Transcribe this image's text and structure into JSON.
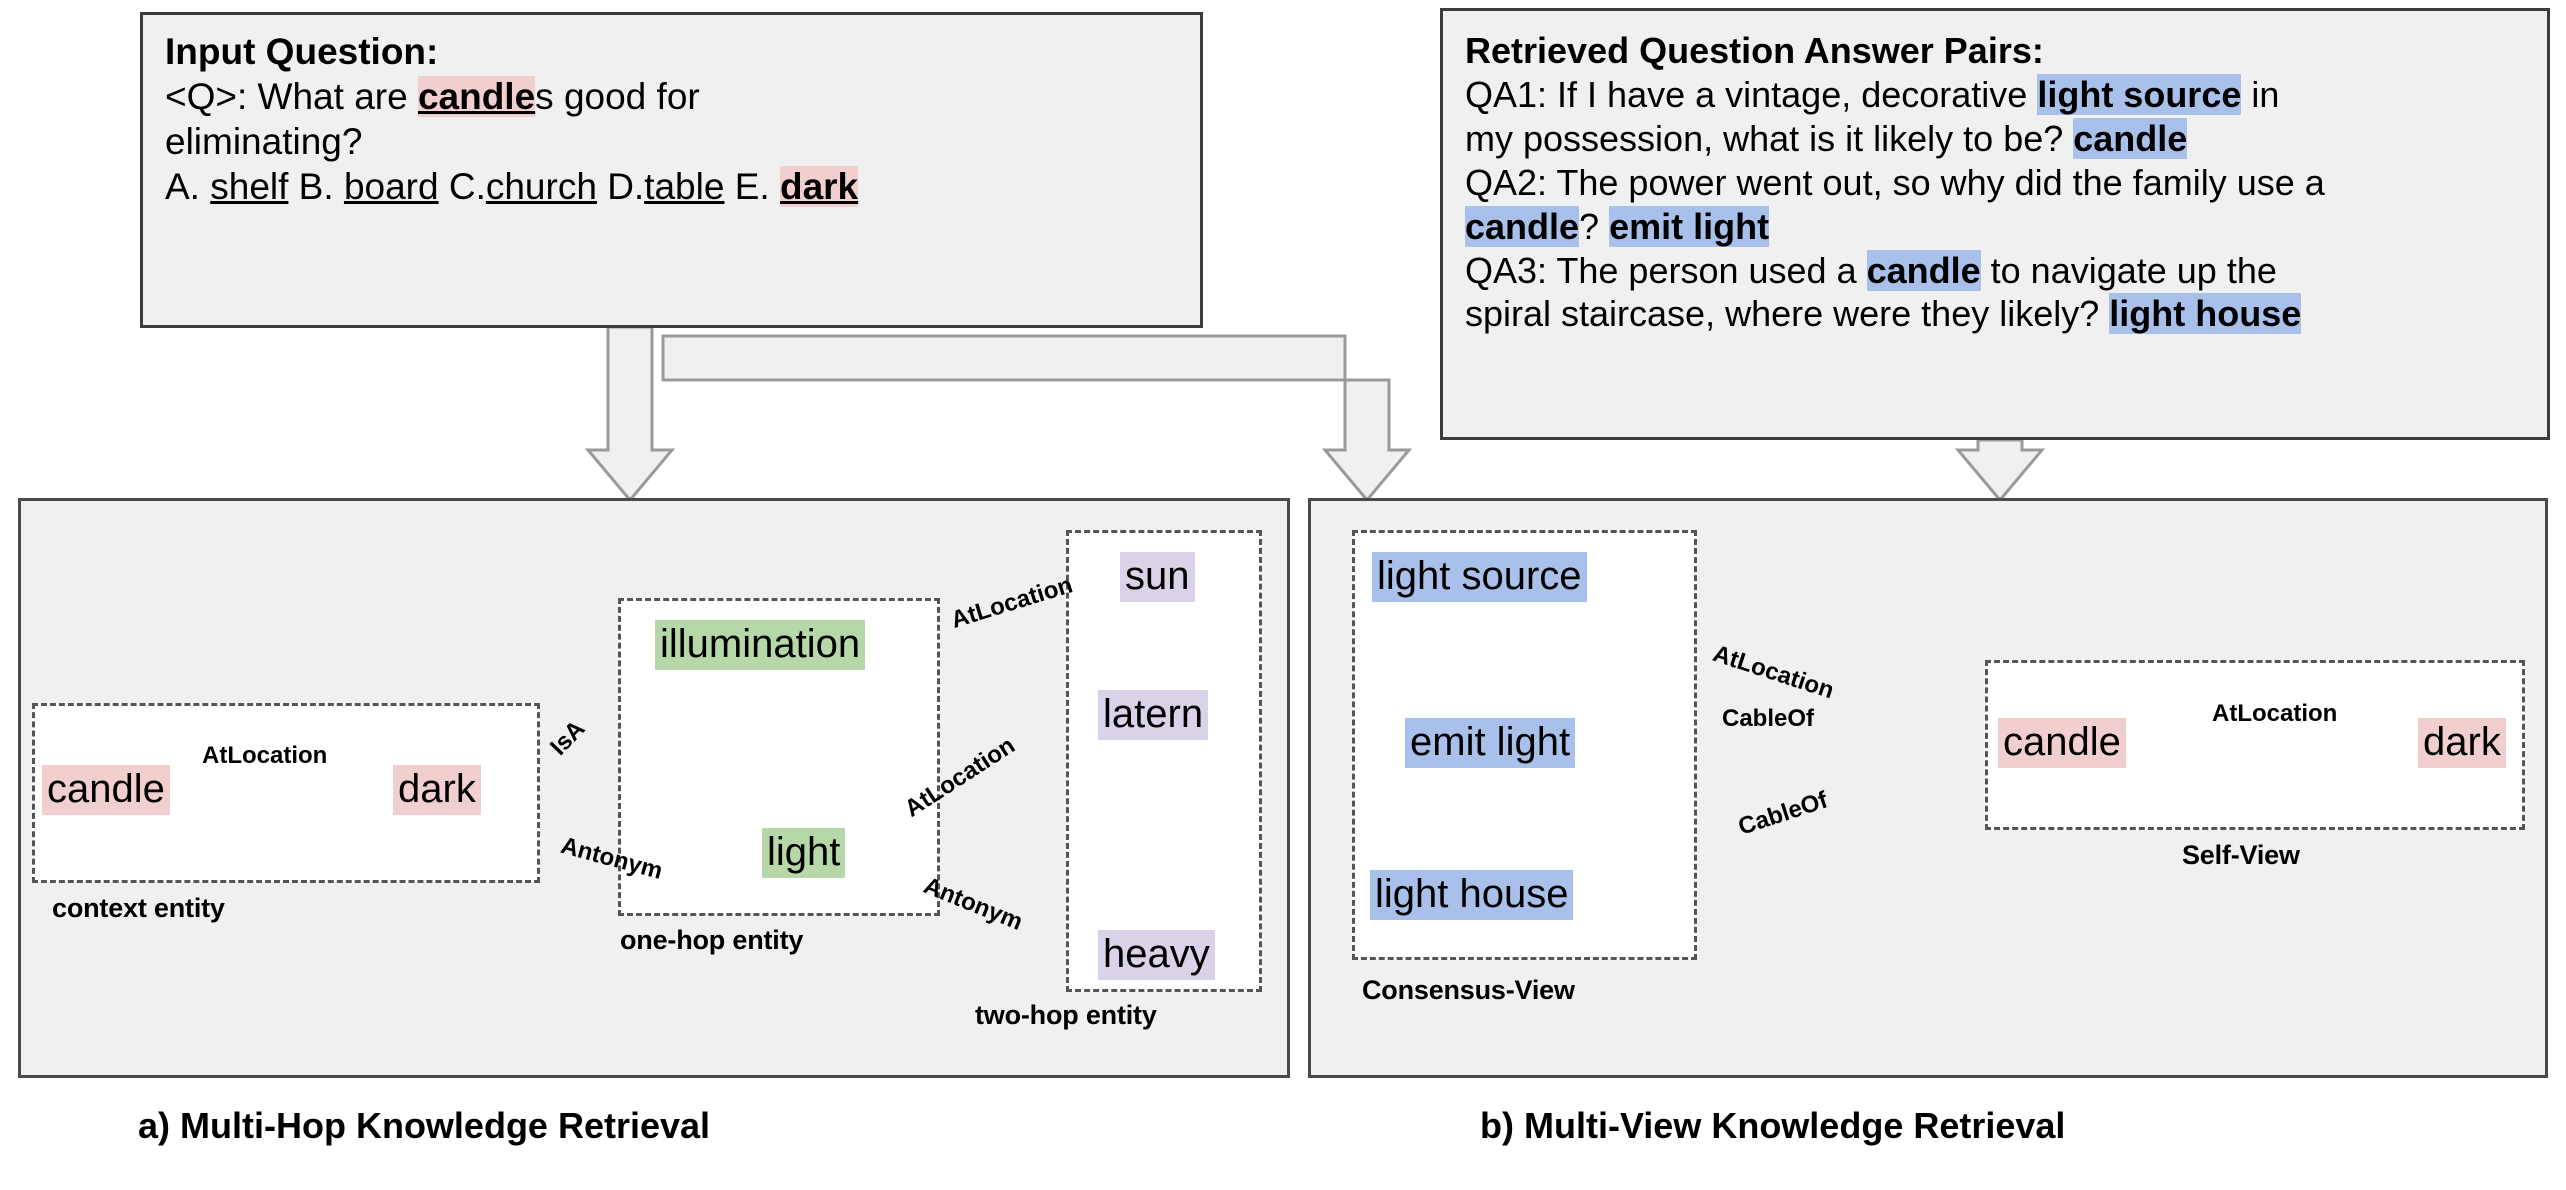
{
  "input_question": {
    "title": "Input Question:",
    "q_prefix": "<Q>: What are ",
    "q_highlight": "candle",
    "q_suffix": "s good for",
    "q_line2": "eliminating?",
    "options_prefix_a": "A. ",
    "option_a": "shelf",
    "options_prefix_b": " B. ",
    "option_b": "board",
    "options_prefix_c": " C.",
    "option_c": "church",
    "options_prefix_d": " D.",
    "option_d": "table",
    "options_prefix_e": " E. ",
    "option_e": "dark"
  },
  "retrieved_qa": {
    "title": "Retrieved Question Answer Pairs:",
    "qa1_part1": "QA1: If I have a vintage, decorative ",
    "qa1_hl1": "light source",
    "qa1_part2": " in",
    "qa1_part3": "my possession, what is it likely to be? ",
    "qa1_hl2": "candle",
    "qa2_part1": "QA2: The power went out, so why did the family use a",
    "qa2_hl1": "candle",
    "qa2_mid": "? ",
    "qa2_hl2": "emit light",
    "qa3_part1": "QA3: The person used a ",
    "qa3_hl1": "candle",
    "qa3_part2": " to navigate up the",
    "qa3_part3": "spiral staircase, where were they likely? ",
    "qa3_hl2": "light house"
  },
  "panel_a": {
    "caption": "a)  Multi-Hop Knowledge Retrieval",
    "groups": [
      {
        "label": "context entity"
      },
      {
        "label": "one-hop entity"
      },
      {
        "label": "two-hop entity"
      }
    ],
    "nodes": [
      {
        "id": "candle",
        "label": "candle",
        "color": "pink"
      },
      {
        "id": "dark",
        "label": "dark",
        "color": "pink"
      },
      {
        "id": "illumination",
        "label": "illumination",
        "color": "green"
      },
      {
        "id": "light",
        "label": "light",
        "color": "green"
      },
      {
        "id": "sun",
        "label": "sun",
        "color": "purple"
      },
      {
        "id": "latern",
        "label": "latern",
        "color": "purple"
      },
      {
        "id": "heavy",
        "label": "heavy",
        "color": "purple"
      }
    ],
    "edges": [
      {
        "from": "candle",
        "to": "dark",
        "label": "AtLocation"
      },
      {
        "from": "dark",
        "to": "illumination",
        "label": "IsA"
      },
      {
        "from": "dark",
        "to": "light",
        "label": "Antonym"
      },
      {
        "from": "illumination",
        "to": "sun",
        "label": "AtLocation"
      },
      {
        "from": "light",
        "to": "latern",
        "label": "AtLocation"
      },
      {
        "from": "light",
        "to": "heavy",
        "label": "Antonym"
      }
    ]
  },
  "panel_b": {
    "caption": "b)  Multi-View Knowledge Retrieval",
    "groups": [
      {
        "label": "Consensus-View"
      },
      {
        "label": "Self-View"
      }
    ],
    "nodes": [
      {
        "id": "light_source",
        "label": "light source",
        "color": "blue"
      },
      {
        "id": "emit_light",
        "label": "emit light",
        "color": "blue"
      },
      {
        "id": "light_house",
        "label": "light house",
        "color": "blue"
      },
      {
        "id": "candle",
        "label": "candle",
        "color": "pink"
      },
      {
        "id": "dark",
        "label": "dark",
        "color": "pink"
      }
    ],
    "edges": [
      {
        "from": "light_source",
        "to": "candle",
        "label": "AtLocation"
      },
      {
        "from": "candle",
        "to": "emit_light",
        "label": "CableOf"
      },
      {
        "from": "candle",
        "to": "light_house",
        "label": "CableOf"
      },
      {
        "from": "candle",
        "to": "dark",
        "label": "AtLocation"
      }
    ]
  },
  "colors": {
    "pink": "#f2cfcf",
    "blue": "#a8c0ea",
    "green": "#b6d7a8",
    "purple": "#d9d2e9",
    "panel_bg": "#f0f0f0",
    "edge": "#555555"
  }
}
